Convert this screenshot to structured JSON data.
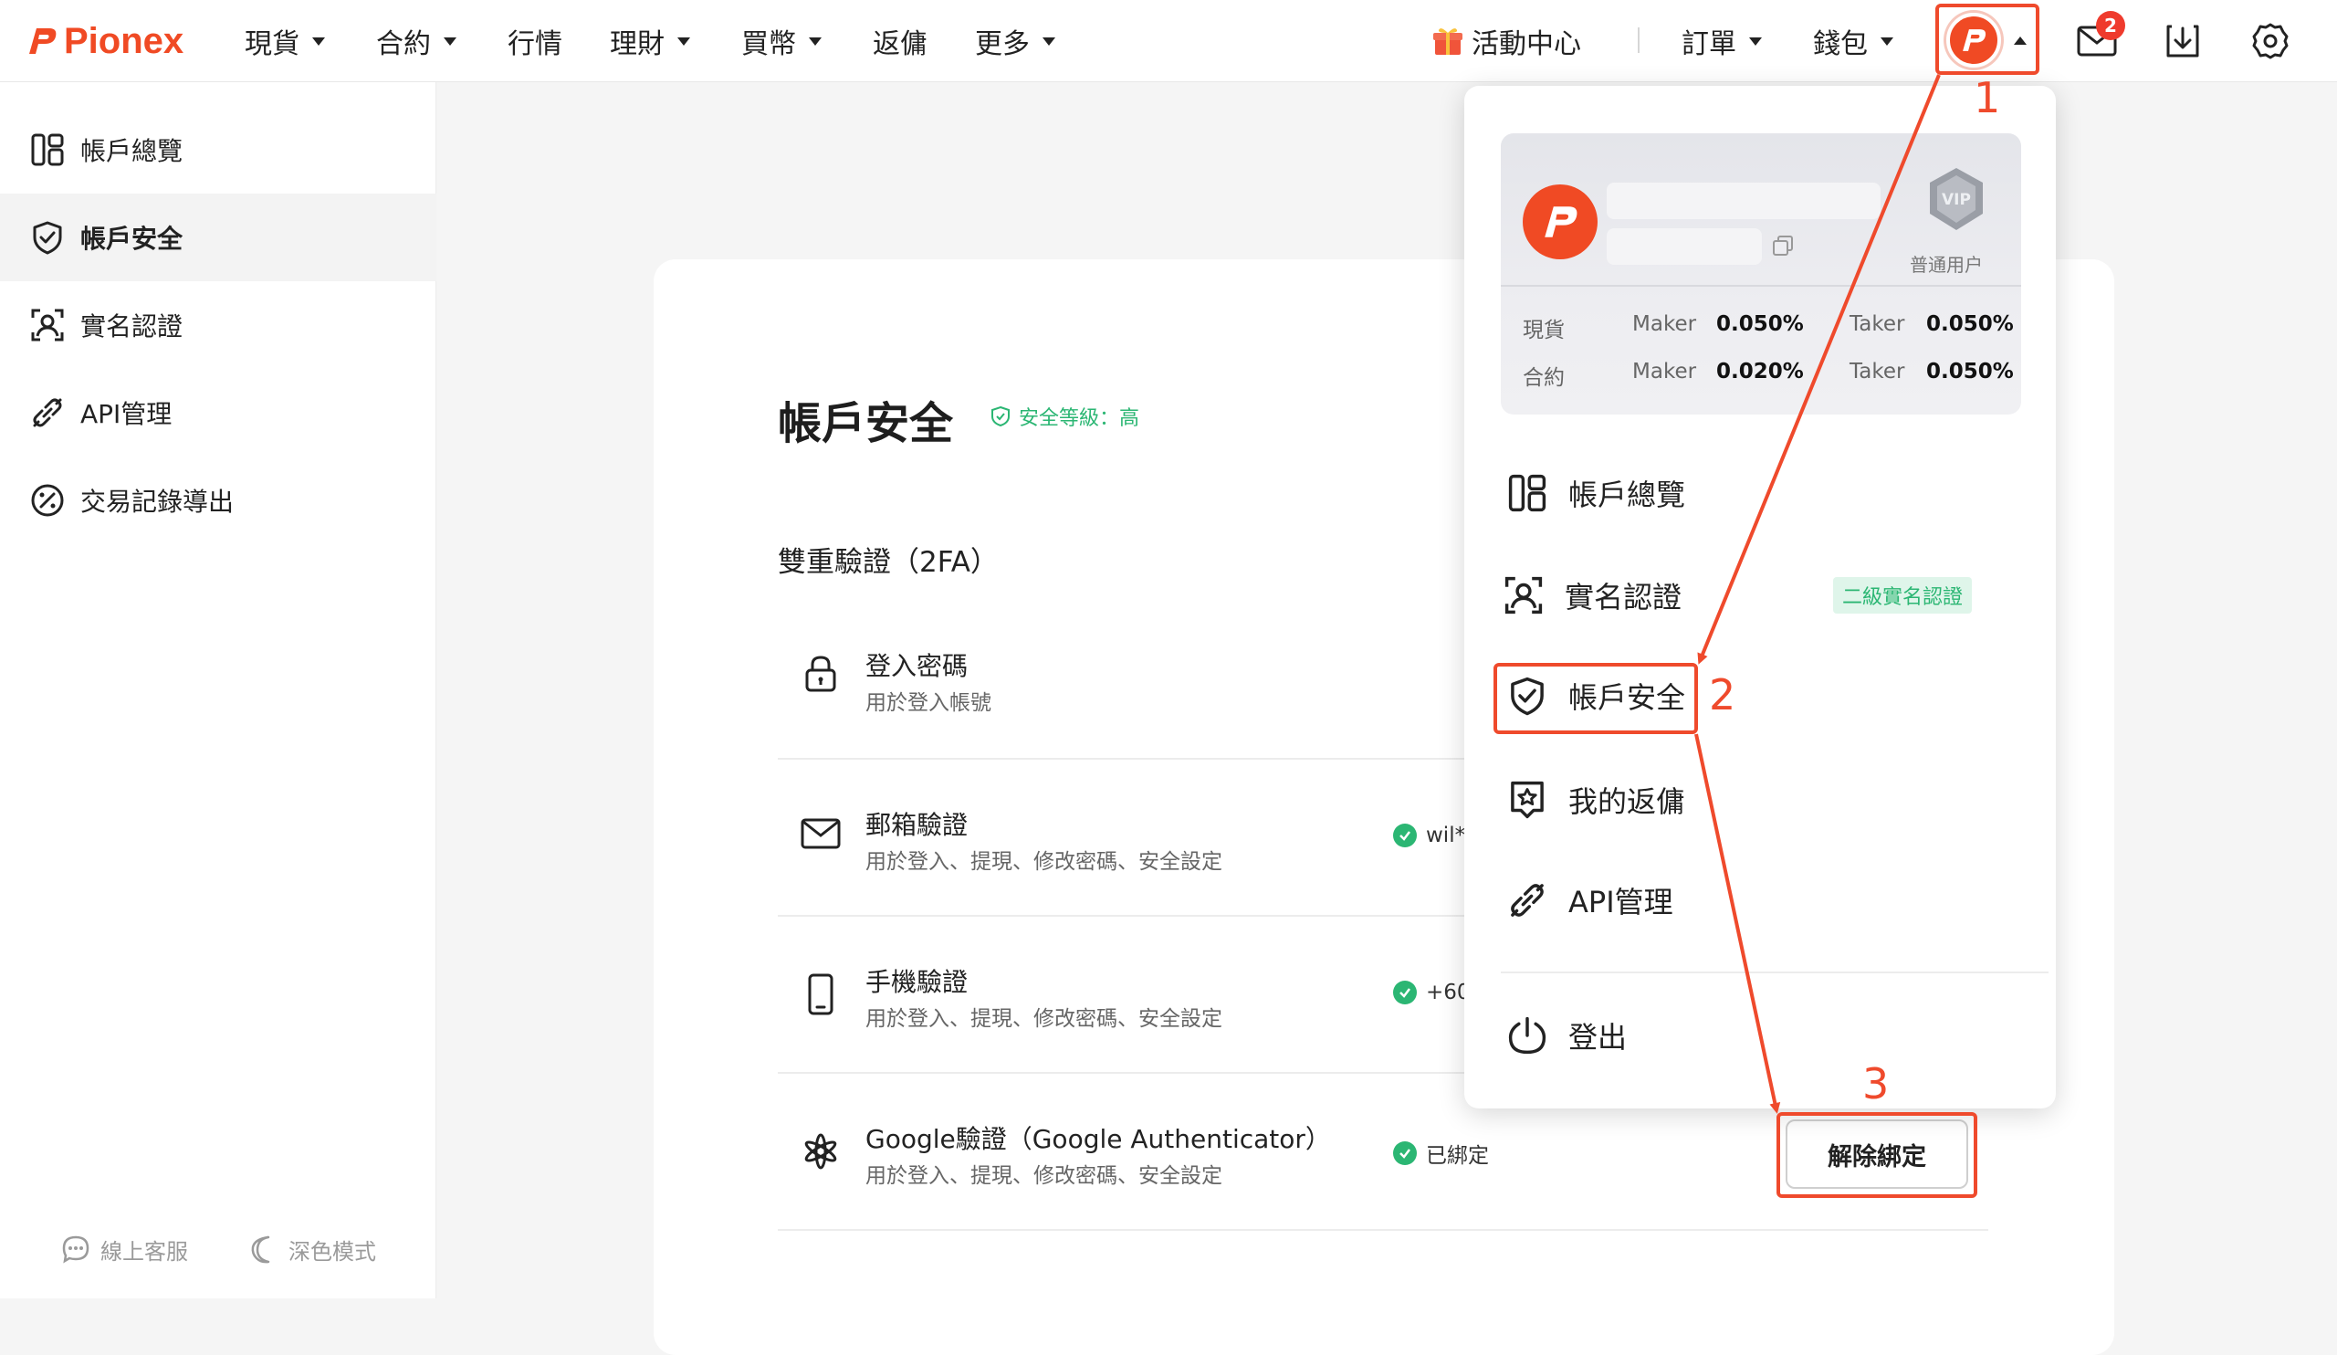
{
  "brand": {
    "name": "Pionex",
    "color": "#f04a24"
  },
  "nav": {
    "spot": "現貨",
    "futures": "合約",
    "market": "行情",
    "earn": "理財",
    "buy": "買幣",
    "rebate": "返傭",
    "more": "更多",
    "events": "活動中心",
    "orders": "訂單",
    "wallet": "錢包",
    "mail_badge": "2"
  },
  "sidebar": {
    "items": [
      {
        "label": "帳戶總覽",
        "icon": "dashboard-icon"
      },
      {
        "label": "帳戶安全",
        "icon": "shield-check-icon",
        "active": true
      },
      {
        "label": "實名認證",
        "icon": "user-verify-icon"
      },
      {
        "label": "API管理",
        "icon": "api-link-icon"
      },
      {
        "label": "交易記錄導出",
        "icon": "percent-export-icon"
      }
    ],
    "support": "線上客服",
    "dark_mode": "深色模式"
  },
  "main": {
    "title": "帳戶安全",
    "security_level": "安全等級：高",
    "section_2fa": "雙重驗證（2FA）",
    "rows": [
      {
        "title": "登入密碼",
        "desc": "用於登入帳號",
        "icon": "lock-icon",
        "status": ""
      },
      {
        "title": "郵箱驗證",
        "desc": "用於登入、提現、修改密碼、安全設定",
        "icon": "mail-icon",
        "status": "wil*"
      },
      {
        "title": "手機驗證",
        "desc": "用於登入、提現、修改密碼、安全設定",
        "icon": "phone-icon",
        "status": "+60"
      },
      {
        "title": "Google驗證（Google Authenticator）",
        "desc": "用於登入、提現、修改密碼、安全設定",
        "icon": "authenticator-icon",
        "status": "已綁定"
      }
    ],
    "unbind_button": "解除綁定"
  },
  "dropdown": {
    "user_type": "普通用户",
    "vip_label": "VIP",
    "fees": {
      "spot_label": "現貨",
      "futures_label": "合約",
      "maker": "Maker",
      "taker": "Taker",
      "spot_maker": "0.050%",
      "spot_taker": "0.050%",
      "futures_maker": "0.020%",
      "futures_taker": "0.050%"
    },
    "items": {
      "overview": "帳戶總覽",
      "kyc": "實名認證",
      "kyc_tag": "二級實名認證",
      "security": "帳戶安全",
      "rebate": "我的返傭",
      "api": "API管理",
      "logout": "登出"
    }
  },
  "annotations": {
    "step1": "1",
    "step2": "2",
    "step3": "3",
    "color": "#ef4a2c"
  }
}
